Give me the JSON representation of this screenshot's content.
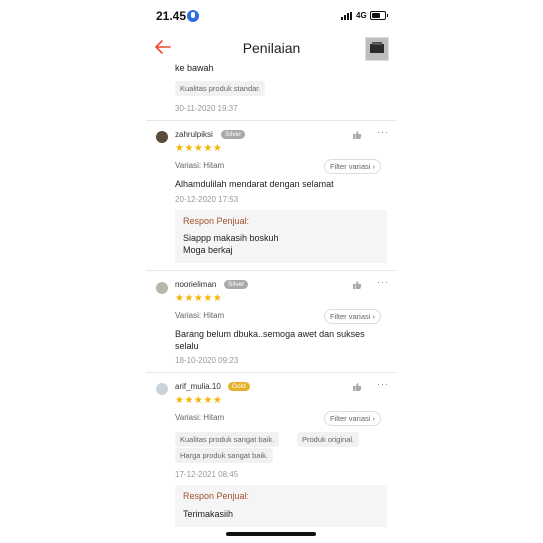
{
  "status": {
    "time": "21.45",
    "network": "4G"
  },
  "header": {
    "title": "Penilaian"
  },
  "colors": {
    "accent": "#ee4d2d",
    "star": "#f5b400",
    "silver": "#a9a9a9",
    "gold": "#e6b12a",
    "reply_title": "#a0522d"
  },
  "prev_review": {
    "cut_text": "ke bawah",
    "tags": [
      "Kualitas produk standar."
    ],
    "date": "30-11-2020 19:37"
  },
  "reviews": [
    {
      "username": "zahrulpiksi",
      "badge": "Silver",
      "stars": "★★★★★",
      "variant": "Variasi: Hitam",
      "filter": "Filter variasi ›",
      "text": "Alhamdulilah mendarat dengan selamat",
      "date": "20-12-2020 17:53",
      "reply_title": "Respon Penjual:",
      "reply_text": "Siappp makasih boskuh\nMoga berkaj"
    },
    {
      "username": "noorieliman",
      "badge": "Silver",
      "stars": "★★★★★",
      "variant": "Variasi: Hitam",
      "filter": "Filter variasi ›",
      "text": "Barang belum dbuka..semoga awet dan sukses selalu",
      "date": "18-10-2020 09:23"
    },
    {
      "username": "arif_mulia.10",
      "badge": "Gold",
      "stars": "★★★★★",
      "variant": "Variasi: Hitam",
      "filter": "Filter variasi ›",
      "tags": [
        "Kualitas produk sangat baik.",
        "Produk original.",
        "Harga produk sangat baik."
      ],
      "date": "17-12-2021 08:45",
      "reply_title": "Respon Penjual:",
      "reply_text": "Terimakasiih"
    }
  ]
}
